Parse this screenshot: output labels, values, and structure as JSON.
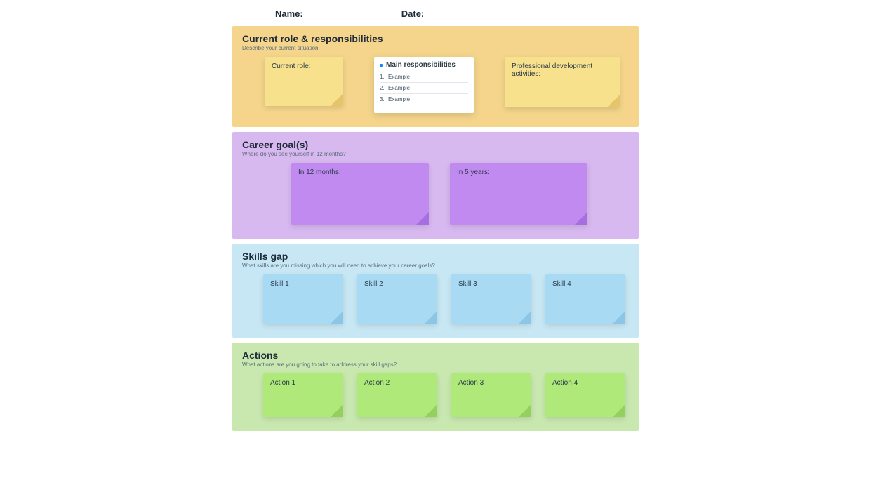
{
  "header": {
    "name_label": "Name:",
    "date_label": "Date:"
  },
  "section_current": {
    "title": "Current role & responsibilities",
    "subtitle": "Describe your current situation.",
    "note_role": "Current role:",
    "resp_title": "Main responsibilities",
    "resp_items": [
      "Example",
      "Example",
      "Example"
    ],
    "note_pd": "Professional development activities:"
  },
  "section_goals": {
    "title": "Career goal(s)",
    "subtitle": "Where do you see yourself in 12 months?",
    "note_12": "In 12 months:",
    "note_5y": "In 5 years:"
  },
  "section_skills": {
    "title": "Skills gap",
    "subtitle": "What skills are you missing which you will need to achieve your career goals?",
    "notes": [
      "Skill 1",
      "Skill 2",
      "Skill 3",
      "Skill 4"
    ]
  },
  "section_actions": {
    "title": "Actions",
    "subtitle": "What actions are you going to take to address your skill gaps?",
    "notes": [
      "Action 1",
      "Action 2",
      "Action 3",
      "Action 4"
    ]
  }
}
